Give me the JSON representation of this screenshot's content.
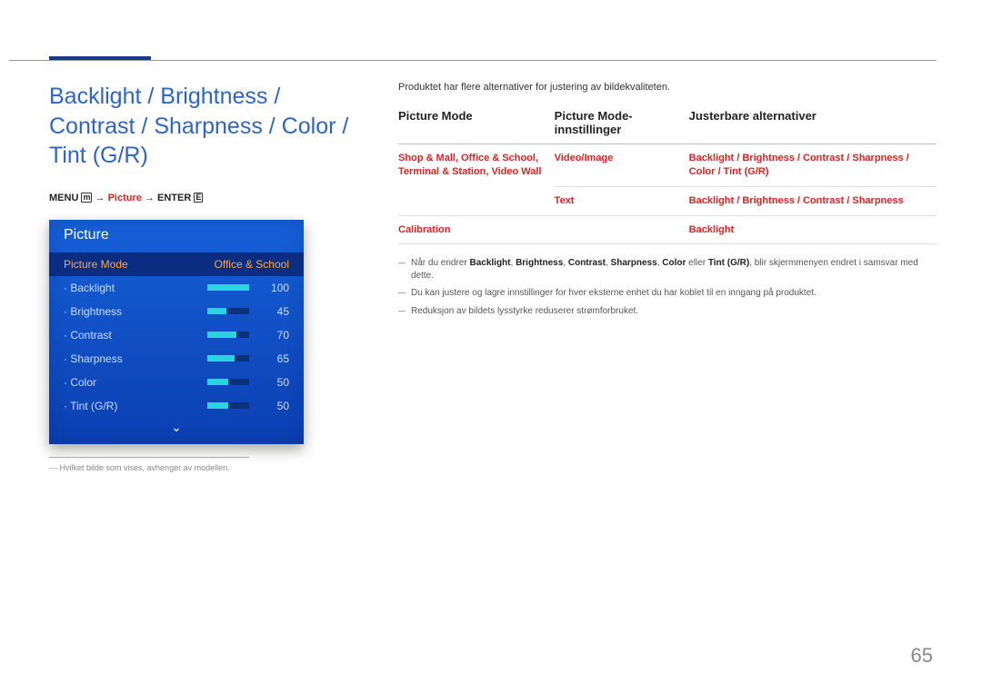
{
  "title": "Backlight / Brightness / Contrast / Sharpness / Color / Tint (G/R)",
  "nav": {
    "menu": "MENU",
    "menu_icon": "m",
    "arrow1": " → ",
    "picture": "Picture",
    "arrow2": " → ",
    "enter": "ENTER",
    "enter_icon": "E"
  },
  "panel": {
    "title": "Picture",
    "mode_label": "Picture Mode",
    "mode_value": "Office & School",
    "items": [
      {
        "label": "Backlight",
        "value": "100",
        "pct": 100
      },
      {
        "label": "Brightness",
        "value": "45",
        "pct": 45
      },
      {
        "label": "Contrast",
        "value": "70",
        "pct": 70
      },
      {
        "label": "Sharpness",
        "value": "65",
        "pct": 65
      },
      {
        "label": "Color",
        "value": "50",
        "pct": 50
      },
      {
        "label": "Tint (G/R)",
        "value": "50",
        "pct": 50
      }
    ]
  },
  "footnote_mark": "―",
  "footnote": "Hvilket bilde som vises, avhenger av modellen.",
  "intro": "Produktet har flere alternativer for justering av bildekvaliteten.",
  "headers": {
    "c1": "Picture Mode",
    "c2": "Picture Mode-innstillinger",
    "c3": "Justerbare alternativer"
  },
  "rows": [
    {
      "c1": "Shop & Mall, Office & School, Terminal & Station, Video Wall",
      "c2": "Video/Image",
      "c3": "Backlight / Brightness / Contrast / Sharpness / Color / Tint (G/R)"
    },
    {
      "c1": "",
      "c2": "Text",
      "c3": "Backlight / Brightness / Contrast / Sharpness"
    },
    {
      "c1": "Calibration",
      "c2": "",
      "c3": "Backlight"
    }
  ],
  "notes": {
    "n1_a": "Når du endrer ",
    "n1_b1": "Backlight",
    "n1_s": ", ",
    "n1_b2": "Brightness",
    "n1_b3": "Contrast",
    "n1_b4": "Sharpness",
    "n1_b5": "Color",
    "n1_m": " eller ",
    "n1_b6": "Tint (G/R)",
    "n1_c": ", blir skjermmenyen endret i samsvar med dette.",
    "n2": "Du kan justere og lagre innstillinger for hver eksterne enhet du har koblet til en inngang på produktet.",
    "n3": "Reduksjon av bildets lysstyrke reduserer strømforbruket."
  },
  "pagenum": "65"
}
